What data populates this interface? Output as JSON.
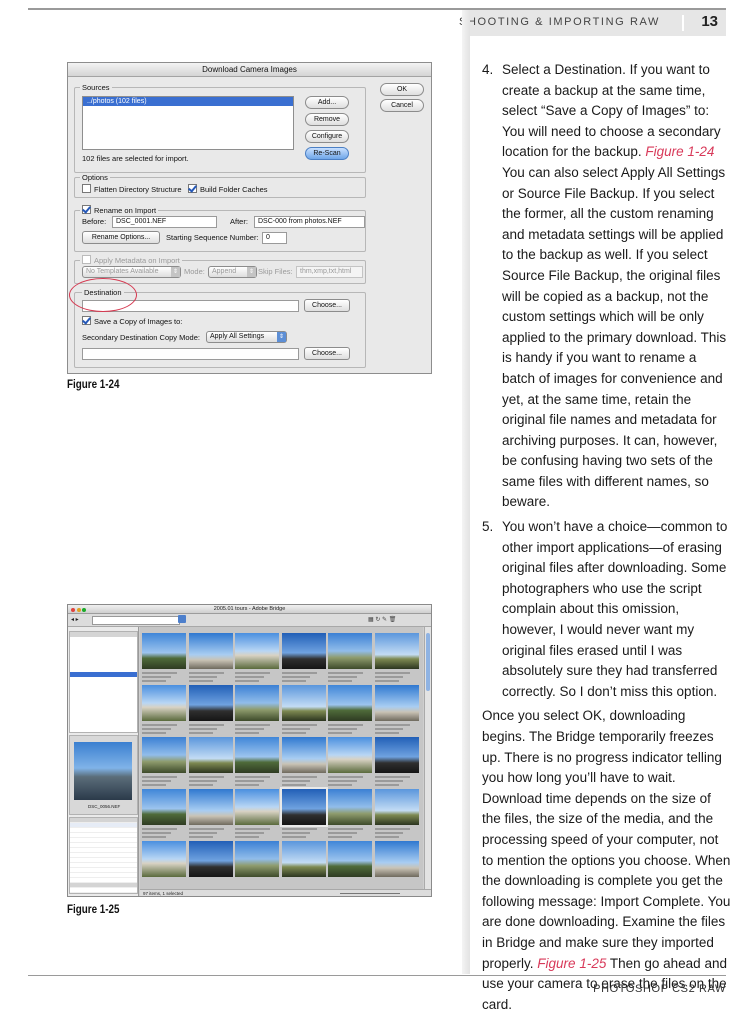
{
  "header": {
    "section": "SHOOTING & IMPORTING RAW",
    "page_number": "13"
  },
  "footer": {
    "book_title": "PHOTOSHOP CS2 RAW"
  },
  "figure_1_24": {
    "caption": "Figure 1-24",
    "dialog": {
      "title": "Download Camera Images",
      "ok": "OK",
      "cancel": "Cancel",
      "sources_label": "Sources",
      "source_item": "../photos (102 files)",
      "add": "Add...",
      "remove": "Remove",
      "configure": "Configure",
      "rescan": "Re-Scan",
      "files_selected": "102 files are selected for import.",
      "options_label": "Options",
      "flatten": "Flatten Directory Structure",
      "build_caches": "Build Folder Caches",
      "rename_label": "Rename on Import",
      "before_label": "Before:",
      "before_value": "DSC_0001.NEF",
      "after_label": "After:",
      "after_value": "DSC-000 from photos.NEF",
      "rename_options": "Rename Options...",
      "starting_seq_label": "Starting Sequence Number:",
      "starting_seq_value": "0",
      "apply_metadata_label": "Apply Metadata on Import",
      "no_templates": "No Templates Available",
      "mode_label": "Mode:",
      "mode_value": "Append",
      "skip_files_label": "Skip Files:",
      "skip_files_value": "thm,xmp,txt,html",
      "destination_label": "Destination",
      "choose": "Choose...",
      "save_copy": "Save a Copy of Images to:",
      "secondary_mode_label": "Secondary Destination Copy Mode:",
      "secondary_mode_value": "Apply All Settings",
      "choose2": "Choose..."
    }
  },
  "figure_1_25": {
    "caption": "Figure 1-25",
    "bridge": {
      "window_title": "2005.01 tours - Adobe Bridge",
      "preview_caption": "DSC_0056.NEF",
      "status_text": "97 items, 1 selected"
    }
  },
  "body": {
    "item4": {
      "number": "4.",
      "text_a": "Select a Destination. If you want to create a backup at the same time, select “Save a Copy of Images” to: You will need to choose a secondary location for the backup.",
      "ref": "Figure 1-24",
      "text_b": "You can also select Apply All Settings or Source File Backup. If you select the former, all the custom renaming and metadata settings will be applied to the backup as well. If you select Source File Backup, the original files will be copied as a backup, not the custom settings which will be only applied to the primary download. This is handy if you want to rename a batch of images for convenience and yet, at the same time, retain the original file names and metadata for archiving purposes. It can, however, be confusing having two sets of the same files with different names, so beware."
    },
    "item5": {
      "number": "5.",
      "text": "You won’t have a choice—common to other import applications—of erasing original files after downloading. Some photographers who use the script complain about this omission, however, I would never want my original files erased until I was absolutely sure they had transferred correctly. So I don’t miss this option."
    },
    "para": {
      "text_a": "Once you select OK, downloading begins. The Bridge temporarily freezes up. There is no progress indicator telling you how long you’ll have to wait. Download time depends on the size of the files, the size of the media, and the processing speed of your computer, not to mention the options you choose. When the downloading is complete you get the following message: Import Complete. You are done downloading. Examine the files in Bridge and make sure they imported properly.",
      "ref": "Figure 1-25",
      "text_b": "Then go ahead and use your camera to erase the files on the card."
    }
  }
}
